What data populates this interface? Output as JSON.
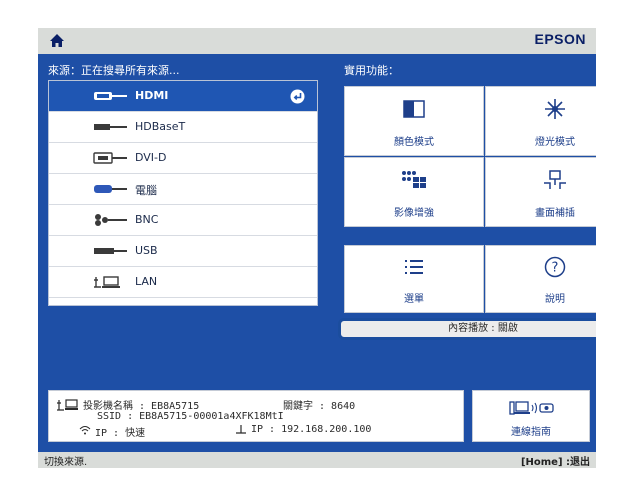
{
  "brand": "EPSON",
  "source_header": "來源：正在搜尋所有來源...",
  "functions_header": "實用功能：",
  "sources": [
    {
      "label": "HDMI",
      "icon": "hdmi-port-icon",
      "selected": true
    },
    {
      "label": "HDBaseT",
      "icon": "hdbaset-port-icon",
      "selected": false
    },
    {
      "label": "DVI-D",
      "icon": "dvi-port-icon",
      "selected": false
    },
    {
      "label": "電腦",
      "icon": "computer-port-icon",
      "selected": false
    },
    {
      "label": "BNC",
      "icon": "bnc-port-icon",
      "selected": false
    },
    {
      "label": "USB",
      "icon": "usb-port-icon",
      "selected": false
    },
    {
      "label": "LAN",
      "icon": "lan-icon",
      "selected": false
    }
  ],
  "functions": [
    {
      "label": "顏色模式",
      "icon": "color-mode-icon"
    },
    {
      "label": "燈光模式",
      "icon": "light-mode-icon"
    },
    {
      "label": "影像增強",
      "icon": "image-enhance-icon"
    },
    {
      "label": "畫面補插",
      "icon": "screen-interpolation-icon"
    },
    {
      "label": "選單",
      "icon": "menu-icon"
    },
    {
      "label": "說明",
      "icon": "help-icon"
    }
  ],
  "content_playback": "內容播放 : 關啟",
  "info": {
    "projector_name": "投影機名稱 : EB8A5715",
    "keyword": "關鍵字 : 8640",
    "ssid": "SSID : EB8A5715-00001a4XFK18MtI",
    "wifi_ip": "IP : 快速",
    "lan_ip": "IP : 192.168.200.100"
  },
  "guide_label": "連線指南",
  "footer_left": "切換來源.",
  "footer_right": "[Home] :退出",
  "colors": {
    "screen_bg": "#1e4fa6",
    "selected_bg": "#1f56b3",
    "brand": "#0a1f66",
    "focus_border": "#1b4d9e"
  }
}
